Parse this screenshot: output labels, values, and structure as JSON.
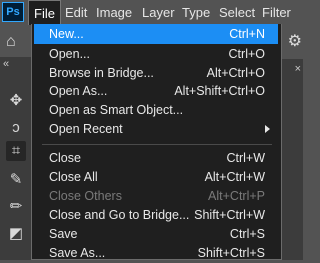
{
  "menubar": {
    "logo": "Ps",
    "items": [
      "File",
      "Edit",
      "Image",
      "Layer",
      "Type",
      "Select",
      "Filter"
    ]
  },
  "file_menu": {
    "items": [
      {
        "label": "New...",
        "shortcut": "Ctrl+N",
        "highlighted": true
      },
      {
        "label": "Open...",
        "shortcut": "Ctrl+O"
      },
      {
        "label": "Browse in Bridge...",
        "shortcut": "Alt+Ctrl+O"
      },
      {
        "label": "Open As...",
        "shortcut": "Alt+Shift+Ctrl+O"
      },
      {
        "label": "Open as Smart Object...",
        "shortcut": ""
      },
      {
        "label": "Open Recent",
        "shortcut": "",
        "submenu": true
      },
      {
        "label": "Close",
        "shortcut": "Ctrl+W"
      },
      {
        "label": "Close All",
        "shortcut": "Alt+Ctrl+W"
      },
      {
        "label": "Close Others",
        "shortcut": "Alt+Ctrl+P",
        "disabled": true
      },
      {
        "label": "Close and Go to Bridge...",
        "shortcut": "Shift+Ctrl+W"
      },
      {
        "label": "Save",
        "shortcut": "Ctrl+S"
      },
      {
        "label": "Save As...",
        "shortcut": "Shift+Ctrl+S"
      }
    ]
  },
  "left_panel": {
    "collapse_glyph": "«"
  },
  "right_panel": {
    "close_glyph": "×"
  },
  "icons": [
    "move-icon",
    "lasso-icon",
    "crop-icon",
    "eyedropper-icon",
    "brush-icon",
    "eraser-icon",
    "gear-icon"
  ]
}
